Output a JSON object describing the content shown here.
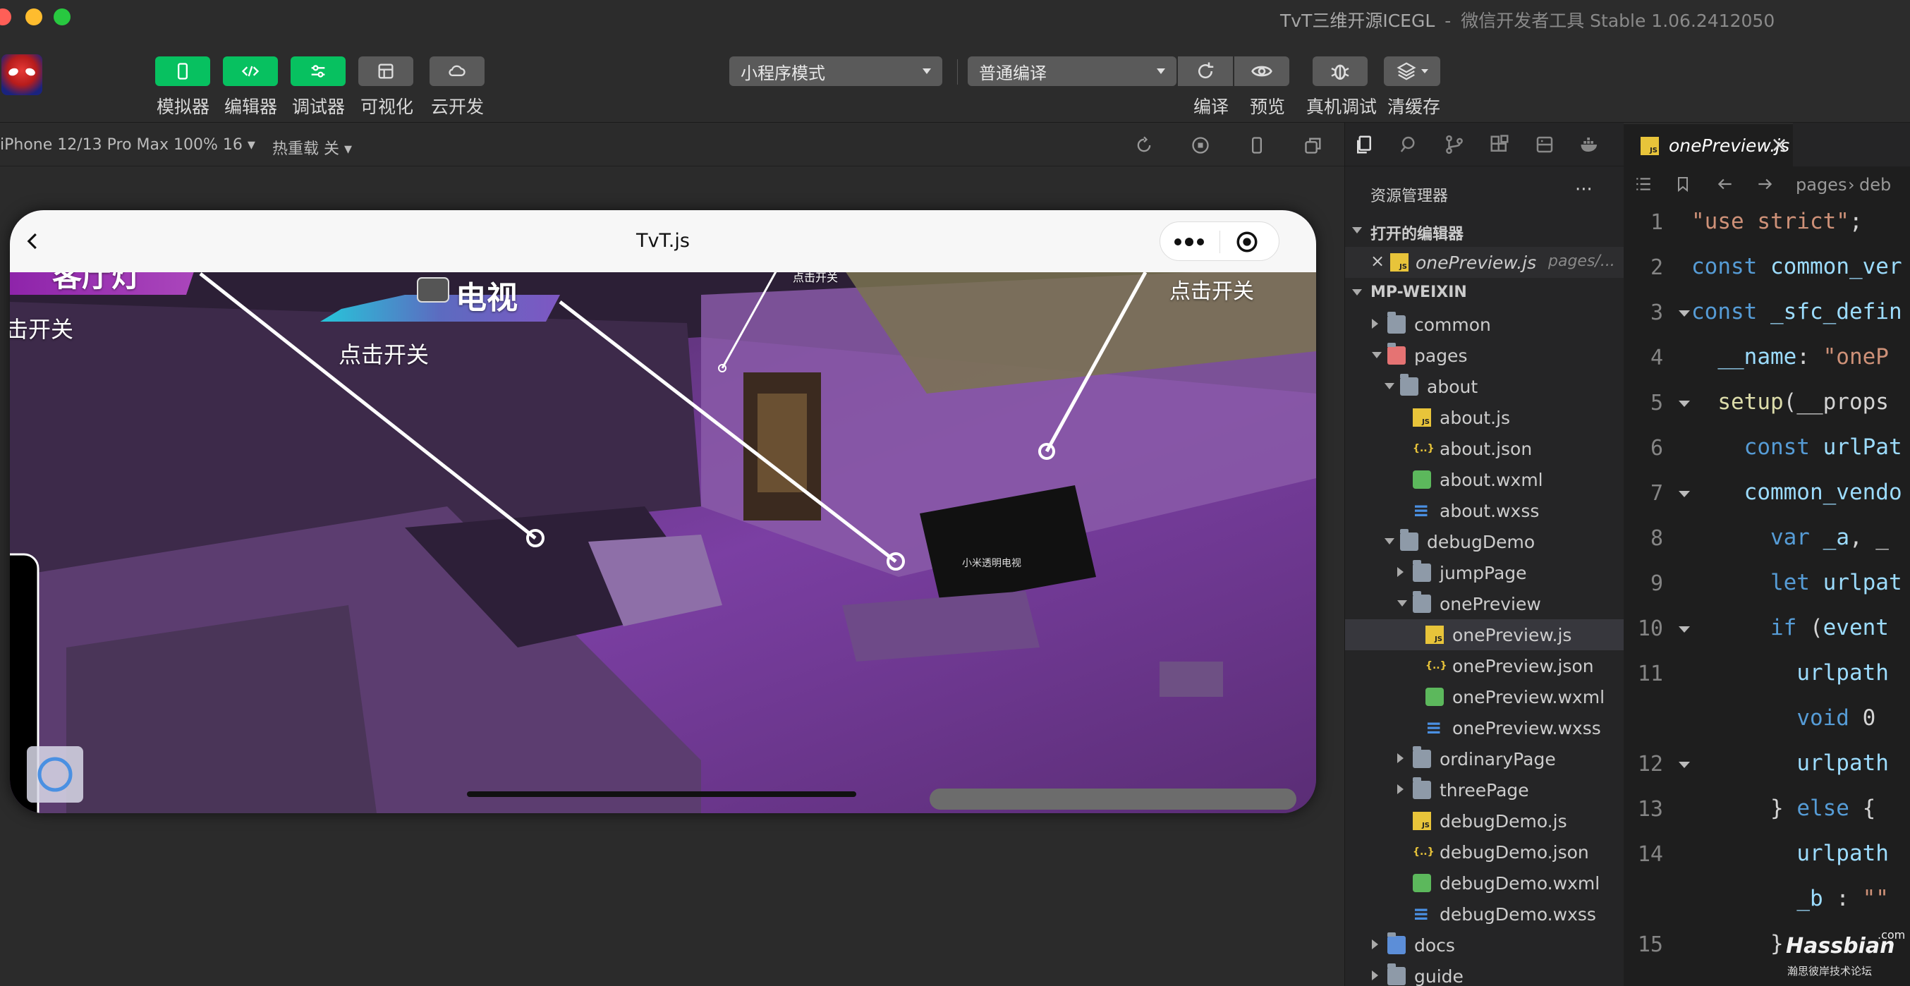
{
  "window": {
    "title": "TvT三维开源ICEGL",
    "subtitle": "微信开发者工具 Stable 1.06.2412050",
    "separator": "-"
  },
  "toolbar": {
    "buttons": [
      {
        "label": "模拟器",
        "icon": "phone-icon",
        "style": "green"
      },
      {
        "label": "编辑器",
        "icon": "code-icon",
        "style": "green"
      },
      {
        "label": "调试器",
        "icon": "sliders-icon",
        "style": "green"
      },
      {
        "label": "可视化",
        "icon": "layout-icon",
        "style": "gray"
      },
      {
        "label": "云开发",
        "icon": "cloud-icon",
        "style": "gray"
      }
    ],
    "mode_select": "小程序模式",
    "compile_select": "普通编译",
    "actions": [
      {
        "label": "编译",
        "icon": "refresh-icon"
      },
      {
        "label": "预览",
        "icon": "eye-icon"
      },
      {
        "label": "真机调试",
        "icon": "bug-icon"
      },
      {
        "label": "清缓存",
        "icon": "layers-icon"
      }
    ]
  },
  "simulator": {
    "device": "iPhone 12/13 Pro Max 100% 16",
    "hot_reload": "热重载 关",
    "page_title": "TvT.js",
    "labels": {
      "living_room_light": "客厅灯",
      "tv": "电视",
      "toggle_left": "击开关",
      "toggle_tv": "点击开关",
      "toggle_small": "点击开关",
      "toggle_right": "点击开关",
      "tv_screen": "小米透明电视"
    }
  },
  "explorer": {
    "title": "资源管理器",
    "more": "···",
    "open_editors_header": "打开的编辑器",
    "open_file": "onePreview.js",
    "open_file_path": "pages/...",
    "project_header": "MP-WEIXIN",
    "tree": [
      {
        "name": "common",
        "type": "folder",
        "depth": 1,
        "state": "collapsed"
      },
      {
        "name": "pages",
        "type": "folder-special",
        "depth": 1,
        "state": "expanded"
      },
      {
        "name": "about",
        "type": "folder",
        "depth": 2,
        "state": "expanded"
      },
      {
        "name": "about.js",
        "type": "js",
        "depth": 3
      },
      {
        "name": "about.json",
        "type": "json",
        "depth": 3
      },
      {
        "name": "about.wxml",
        "type": "wxml",
        "depth": 3
      },
      {
        "name": "about.wxss",
        "type": "wxss",
        "depth": 3
      },
      {
        "name": "debugDemo",
        "type": "folder",
        "depth": 2,
        "state": "expanded"
      },
      {
        "name": "jumpPage",
        "type": "folder",
        "depth": 3,
        "state": "collapsed"
      },
      {
        "name": "onePreview",
        "type": "folder",
        "depth": 3,
        "state": "expanded"
      },
      {
        "name": "onePreview.js",
        "type": "js",
        "depth": 4,
        "selected": true
      },
      {
        "name": "onePreview.json",
        "type": "json",
        "depth": 4
      },
      {
        "name": "onePreview.wxml",
        "type": "wxml",
        "depth": 4
      },
      {
        "name": "onePreview.wxss",
        "type": "wxss",
        "depth": 4
      },
      {
        "name": "ordinaryPage",
        "type": "folder",
        "depth": 3,
        "state": "collapsed"
      },
      {
        "name": "threePage",
        "type": "folder",
        "depth": 3,
        "state": "collapsed"
      },
      {
        "name": "debugDemo.js",
        "type": "js",
        "depth": 3
      },
      {
        "name": "debugDemo.json",
        "type": "json",
        "depth": 3
      },
      {
        "name": "debugDemo.wxml",
        "type": "wxml",
        "depth": 3
      },
      {
        "name": "debugDemo.wxss",
        "type": "wxss",
        "depth": 3
      },
      {
        "name": "docs",
        "type": "folder-special",
        "depth": 1,
        "state": "collapsed"
      },
      {
        "name": "guide",
        "type": "folder",
        "depth": 1,
        "state": "collapsed"
      }
    ]
  },
  "editor": {
    "tab": "onePreview.js",
    "tab_close": "×",
    "breadcrumb_a": "pages",
    "breadcrumb_b": "deb",
    "lines": [
      {
        "no": "1",
        "text": "\"use strict\";"
      },
      {
        "no": "2",
        "text": "const common_ver"
      },
      {
        "no": "3",
        "text": "const _sfc_defin"
      },
      {
        "no": "4",
        "text": "  __name: \"oneP"
      },
      {
        "no": "5",
        "text": "  setup(__props"
      },
      {
        "no": "6",
        "text": "    const urlPat"
      },
      {
        "no": "7",
        "text": "    common_vendo"
      },
      {
        "no": "8",
        "text": "      var _a, _"
      },
      {
        "no": "9",
        "text": "      let urlpat"
      },
      {
        "no": "10",
        "text": "      if (event"
      },
      {
        "no": "11",
        "text": "        urlpath"
      },
      {
        "no": "",
        "text": "        void 0"
      },
      {
        "no": "12",
        "text": "        urlpath"
      },
      {
        "no": "13",
        "text": "      } else {"
      },
      {
        "no": "14",
        "text": "        urlpath"
      },
      {
        "no": "",
        "text": "        _b : \"\""
      },
      {
        "no": "15",
        "text": "      }"
      }
    ]
  },
  "watermark": {
    "brand": "Hassbian",
    "suffix": ".com",
    "tagline": "瀚思彼岸技术论坛"
  },
  "colors": {
    "accent_green": "#07c160",
    "purple_scene": "#7b3fa3",
    "editor_bg": "#1e1e1e"
  }
}
